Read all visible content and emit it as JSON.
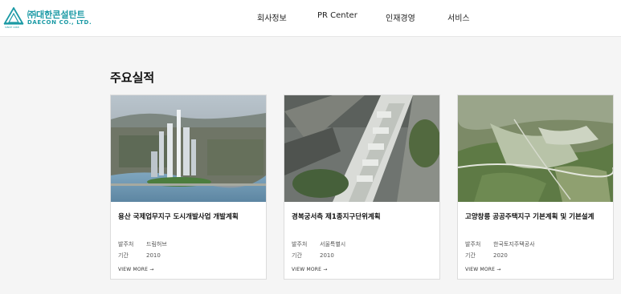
{
  "header": {
    "logo": {
      "korean_name": "㈜대한콘설탄트",
      "english_name": "DAECON CO., LTD.",
      "tagline": "SINCE 1968",
      "icon": "daecon-logo-icon",
      "color": "#1b9aa5"
    },
    "nav": [
      {
        "label": "회사정보"
      },
      {
        "label": "PR Center"
      },
      {
        "label": "인재경영"
      },
      {
        "label": "서비스"
      }
    ]
  },
  "main": {
    "title": "주요실적",
    "cards": [
      {
        "image": "yongsan-aerial-render",
        "title": "용산 국제업무지구 도시개발사업 개발계획",
        "client_label": "발주처",
        "client": "드림허브",
        "period_label": "기간",
        "period": "2010",
        "cta": "VIEW MORE →"
      },
      {
        "image": "gyeongbokgung-district-render",
        "title": "경복궁서측 제1종지구단위계획",
        "client_label": "발주처",
        "client": "서울특별시",
        "period_label": "기간",
        "period": "2010",
        "cta": "VIEW MORE →"
      },
      {
        "image": "goyang-changneung-aerial-render",
        "title": "고양창릉 공공주택지구 기본계획 및 기본설계",
        "client_label": "발주처",
        "client": "한국토지주택공사",
        "period_label": "기간",
        "period": "2020",
        "cta": "VIEW MORE →"
      }
    ]
  }
}
